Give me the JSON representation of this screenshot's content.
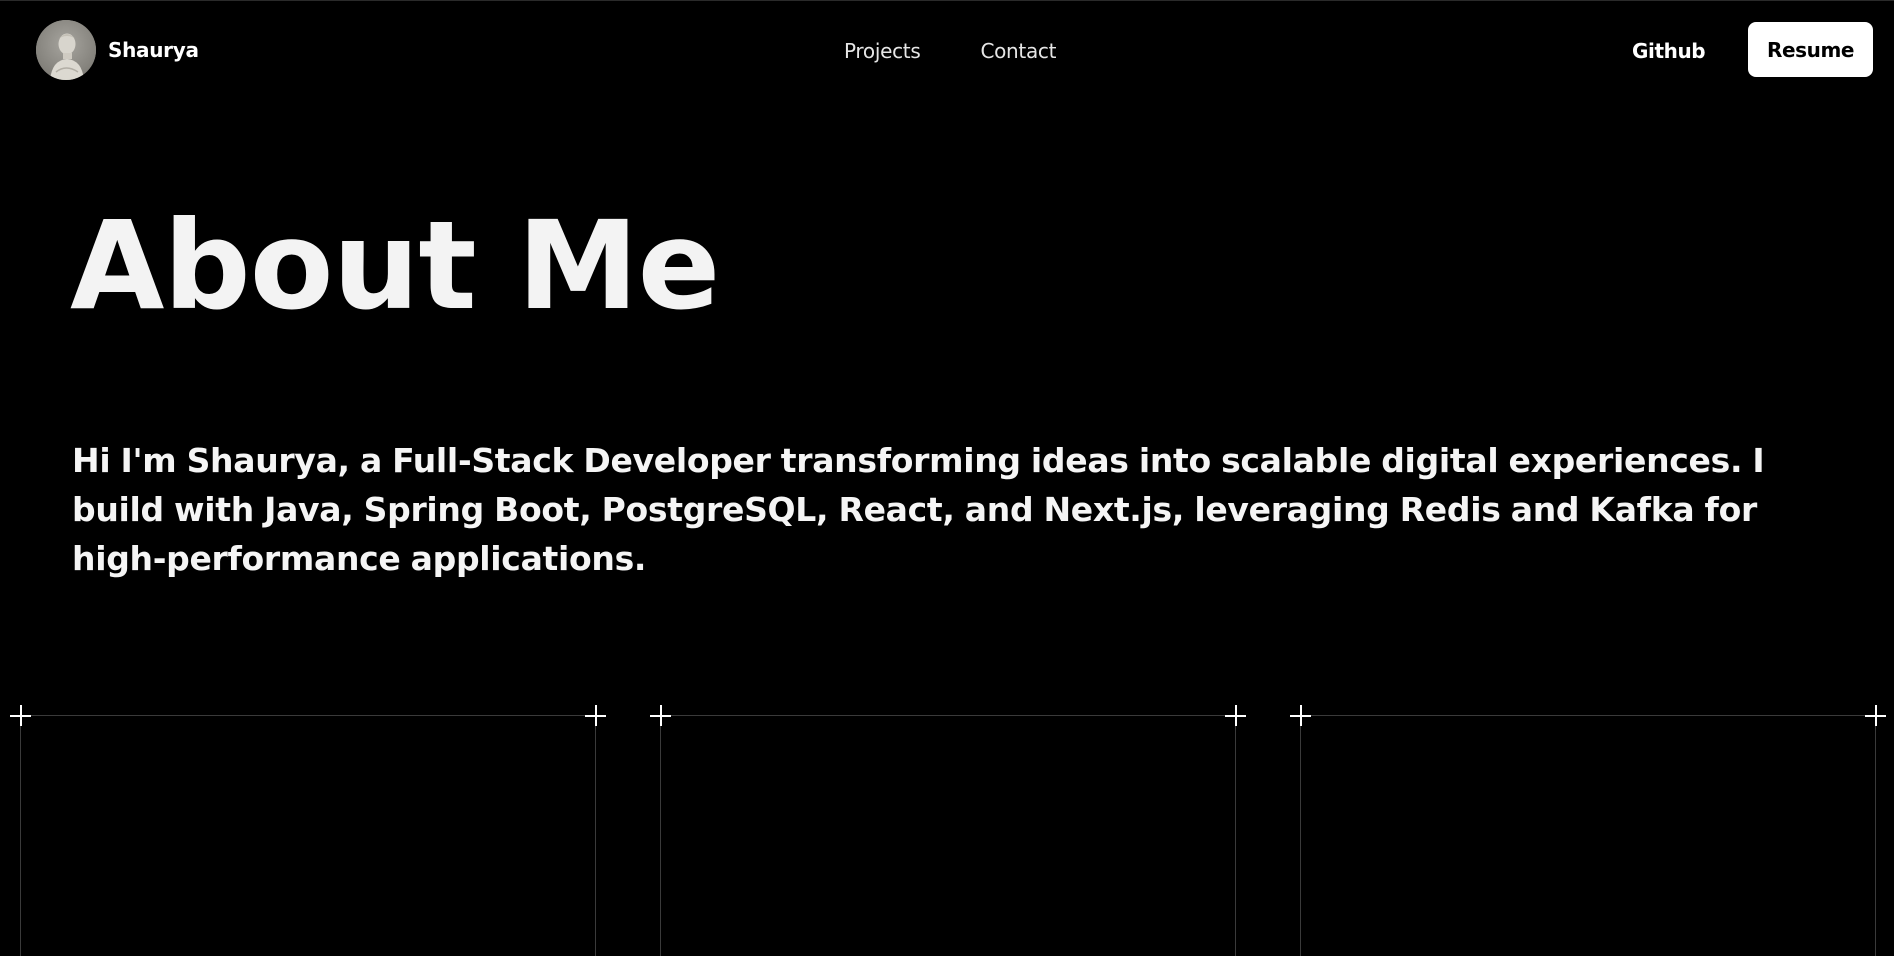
{
  "header": {
    "brand_name": "Shaurya",
    "nav": [
      {
        "label": "Projects"
      },
      {
        "label": "Contact"
      }
    ],
    "github_label": "Github",
    "resume_label": "Resume"
  },
  "main": {
    "title": "About Me",
    "intro": "Hi I'm Shaurya, a Full-Stack Developer transforming ideas into scalable digital experiences. I build with Java, Spring Boot, PostgreSQL, React, and Next.js, leveraging Redis and Kafka for high-performance applications."
  },
  "theme": {
    "background": "#000000",
    "text": "#f2f2f2",
    "button_bg": "#ffffff",
    "button_text": "#000000",
    "card_border": "#3a3a3a"
  }
}
